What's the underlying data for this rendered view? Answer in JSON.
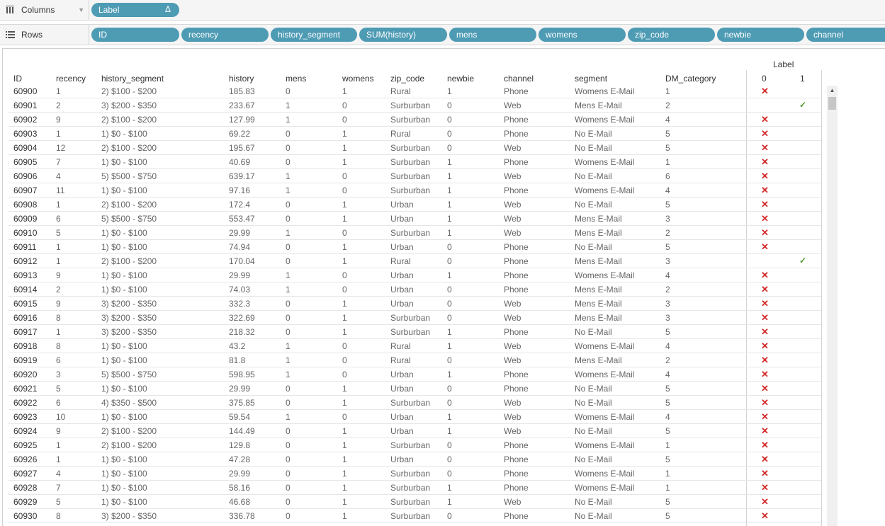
{
  "shelves": {
    "columns": {
      "label": "Columns",
      "icon": "columns-icon",
      "pills": [
        {
          "text": "Label",
          "delta": "Δ"
        }
      ]
    },
    "rows": {
      "label": "Rows",
      "icon": "rows-icon",
      "pills": [
        "ID",
        "recency",
        "history_segment",
        "SUM(history)",
        "mens",
        "womens",
        "zip_code",
        "newbie",
        "channel"
      ]
    }
  },
  "table": {
    "label_header": "Label",
    "label_values": [
      "0",
      "1"
    ],
    "headers": [
      "ID",
      "recency",
      "history_segment",
      "history",
      "mens",
      "womens",
      "zip_code",
      "newbie",
      "channel",
      "segment",
      "DM_category"
    ],
    "rows": [
      [
        "60900",
        "1",
        "2) $100 - $200",
        "185.83",
        "0",
        "1",
        "Rural",
        "1",
        "Phone",
        "Womens E-Mail",
        "1",
        "0"
      ],
      [
        "60901",
        "2",
        "3) $200 - $350",
        "233.67",
        "1",
        "0",
        "Surburban",
        "0",
        "Web",
        "Mens E-Mail",
        "2",
        "1"
      ],
      [
        "60902",
        "9",
        "2) $100 - $200",
        "127.99",
        "1",
        "0",
        "Surburban",
        "0",
        "Phone",
        "Womens E-Mail",
        "4",
        "0"
      ],
      [
        "60903",
        "1",
        "1) $0 - $100",
        "69.22",
        "0",
        "1",
        "Rural",
        "0",
        "Phone",
        "No E-Mail",
        "5",
        "0"
      ],
      [
        "60904",
        "12",
        "2) $100 - $200",
        "195.67",
        "0",
        "1",
        "Surburban",
        "0",
        "Web",
        "No E-Mail",
        "5",
        "0"
      ],
      [
        "60905",
        "7",
        "1) $0 - $100",
        "40.69",
        "0",
        "1",
        "Surburban",
        "1",
        "Phone",
        "Womens E-Mail",
        "1",
        "0"
      ],
      [
        "60906",
        "4",
        "5) $500 - $750",
        "639.17",
        "1",
        "0",
        "Surburban",
        "1",
        "Web",
        "No E-Mail",
        "6",
        "0"
      ],
      [
        "60907",
        "11",
        "1) $0 - $100",
        "97.16",
        "1",
        "0",
        "Surburban",
        "1",
        "Phone",
        "Womens E-Mail",
        "4",
        "0"
      ],
      [
        "60908",
        "1",
        "2) $100 - $200",
        "172.4",
        "0",
        "1",
        "Urban",
        "1",
        "Web",
        "No E-Mail",
        "5",
        "0"
      ],
      [
        "60909",
        "6",
        "5) $500 - $750",
        "553.47",
        "0",
        "1",
        "Urban",
        "1",
        "Web",
        "Mens E-Mail",
        "3",
        "0"
      ],
      [
        "60910",
        "5",
        "1) $0 - $100",
        "29.99",
        "1",
        "0",
        "Surburban",
        "1",
        "Web",
        "Mens E-Mail",
        "2",
        "0"
      ],
      [
        "60911",
        "1",
        "1) $0 - $100",
        "74.94",
        "0",
        "1",
        "Urban",
        "0",
        "Phone",
        "No E-Mail",
        "5",
        "0"
      ],
      [
        "60912",
        "1",
        "2) $100 - $200",
        "170.04",
        "0",
        "1",
        "Rural",
        "0",
        "Phone",
        "Mens E-Mail",
        "3",
        "1"
      ],
      [
        "60913",
        "9",
        "1) $0 - $100",
        "29.99",
        "1",
        "0",
        "Urban",
        "1",
        "Phone",
        "Womens E-Mail",
        "4",
        "0"
      ],
      [
        "60914",
        "2",
        "1) $0 - $100",
        "74.03",
        "1",
        "0",
        "Urban",
        "0",
        "Phone",
        "Mens E-Mail",
        "2",
        "0"
      ],
      [
        "60915",
        "9",
        "3) $200 - $350",
        "332.3",
        "0",
        "1",
        "Urban",
        "0",
        "Web",
        "Mens E-Mail",
        "3",
        "0"
      ],
      [
        "60916",
        "8",
        "3) $200 - $350",
        "322.69",
        "0",
        "1",
        "Surburban",
        "0",
        "Web",
        "Mens E-Mail",
        "3",
        "0"
      ],
      [
        "60917",
        "1",
        "3) $200 - $350",
        "218.32",
        "0",
        "1",
        "Surburban",
        "1",
        "Phone",
        "No E-Mail",
        "5",
        "0"
      ],
      [
        "60918",
        "8",
        "1) $0 - $100",
        "43.2",
        "1",
        "0",
        "Rural",
        "1",
        "Web",
        "Womens E-Mail",
        "4",
        "0"
      ],
      [
        "60919",
        "6",
        "1) $0 - $100",
        "81.8",
        "1",
        "0",
        "Rural",
        "0",
        "Web",
        "Mens E-Mail",
        "2",
        "0"
      ],
      [
        "60920",
        "3",
        "5) $500 - $750",
        "598.95",
        "1",
        "0",
        "Urban",
        "1",
        "Phone",
        "Womens E-Mail",
        "4",
        "0"
      ],
      [
        "60921",
        "5",
        "1) $0 - $100",
        "29.99",
        "0",
        "1",
        "Urban",
        "0",
        "Phone",
        "No E-Mail",
        "5",
        "0"
      ],
      [
        "60922",
        "6",
        "4) $350 - $500",
        "375.85",
        "0",
        "1",
        "Surburban",
        "0",
        "Web",
        "No E-Mail",
        "5",
        "0"
      ],
      [
        "60923",
        "10",
        "1) $0 - $100",
        "59.54",
        "1",
        "0",
        "Urban",
        "1",
        "Web",
        "Womens E-Mail",
        "4",
        "0"
      ],
      [
        "60924",
        "9",
        "2) $100 - $200",
        "144.49",
        "0",
        "1",
        "Urban",
        "1",
        "Web",
        "No E-Mail",
        "5",
        "0"
      ],
      [
        "60925",
        "1",
        "2) $100 - $200",
        "129.8",
        "0",
        "1",
        "Surburban",
        "0",
        "Phone",
        "Womens E-Mail",
        "1",
        "0"
      ],
      [
        "60926",
        "1",
        "1) $0 - $100",
        "47.28",
        "0",
        "1",
        "Urban",
        "0",
        "Phone",
        "No E-Mail",
        "5",
        "0"
      ],
      [
        "60927",
        "4",
        "1) $0 - $100",
        "29.99",
        "0",
        "1",
        "Surburban",
        "0",
        "Phone",
        "Womens E-Mail",
        "1",
        "0"
      ],
      [
        "60928",
        "7",
        "1) $0 - $100",
        "58.16",
        "0",
        "1",
        "Surburban",
        "1",
        "Phone",
        "Womens E-Mail",
        "1",
        "0"
      ],
      [
        "60929",
        "5",
        "1) $0 - $100",
        "46.68",
        "0",
        "1",
        "Surburban",
        "1",
        "Web",
        "No E-Mail",
        "5",
        "0"
      ],
      [
        "60930",
        "8",
        "3) $200 - $350",
        "336.78",
        "0",
        "1",
        "Surburban",
        "0",
        "Phone",
        "No E-Mail",
        "5",
        "0"
      ]
    ],
    "marks": {
      "label_0": "x-mark-icon",
      "label_1": "check-mark-icon",
      "colors": {
        "x": "#d42a2a",
        "check": "#4d9a2a"
      }
    }
  }
}
